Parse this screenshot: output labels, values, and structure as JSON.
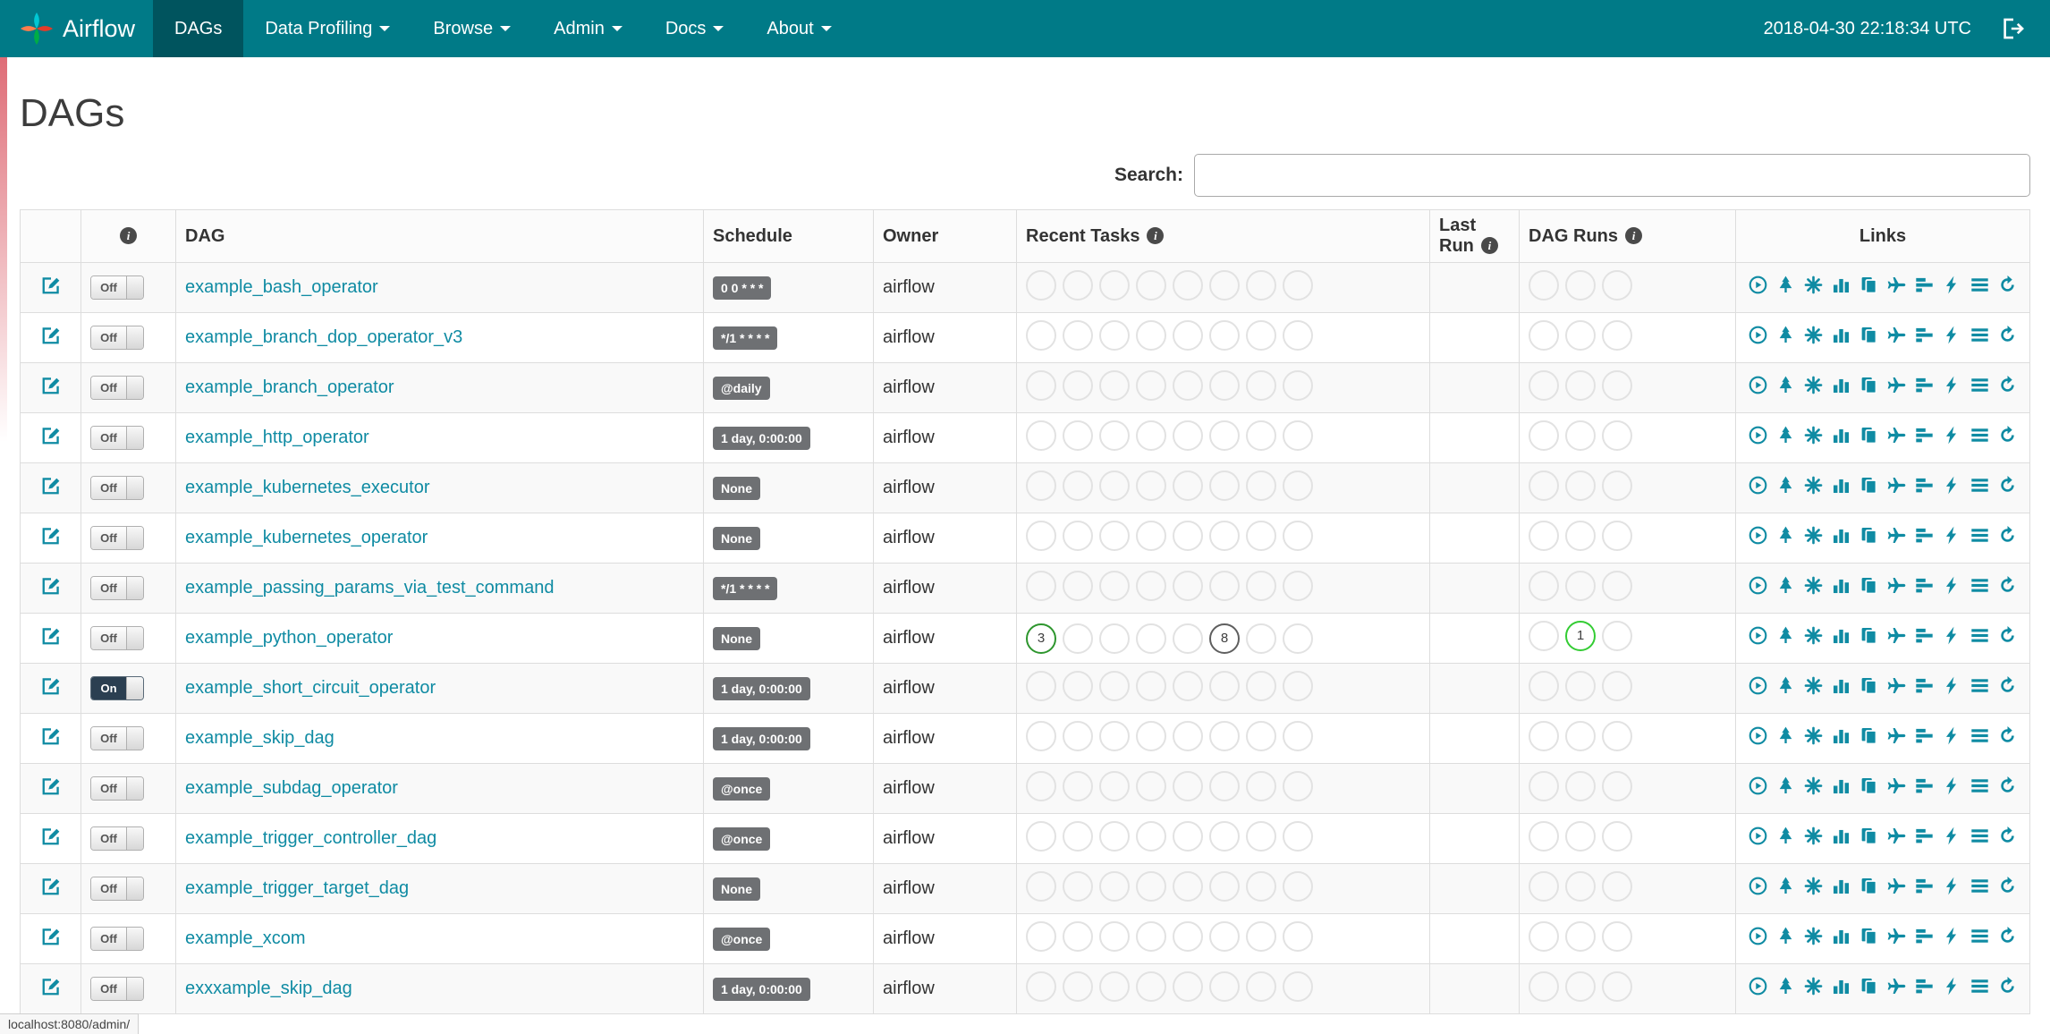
{
  "navbar": {
    "brand": "Airflow",
    "items": [
      {
        "label": "DAGs",
        "active": true,
        "dropdown": false
      },
      {
        "label": "Data Profiling",
        "active": false,
        "dropdown": true
      },
      {
        "label": "Browse",
        "active": false,
        "dropdown": true
      },
      {
        "label": "Admin",
        "active": false,
        "dropdown": true
      },
      {
        "label": "Docs",
        "active": false,
        "dropdown": true
      },
      {
        "label": "About",
        "active": false,
        "dropdown": true
      }
    ],
    "clock": "2018-04-30 22:18:34 UTC"
  },
  "page": {
    "title": "DAGs"
  },
  "search": {
    "label": "Search:",
    "value": ""
  },
  "table": {
    "headers": {
      "dag": "DAG",
      "schedule": "Schedule",
      "owner": "Owner",
      "recent_tasks": "Recent Tasks",
      "last_run": "Last Run",
      "dag_runs": "DAG Runs",
      "links": "Links"
    },
    "toggle": {
      "on_label": "On",
      "off_label": "Off"
    },
    "circle_counts": {
      "recent_tasks": 8,
      "dag_runs": 3
    },
    "state_colors": {
      "success": "#2e962e",
      "running": "#33cc33",
      "none": "#5f5f5f",
      "default": "#e2e2e2"
    },
    "links": [
      "play-circle",
      "tree",
      "graph",
      "bar-chart",
      "copy",
      "plane",
      "gantt",
      "lightning",
      "list",
      "refresh"
    ],
    "rows": [
      {
        "name": "example_bash_operator",
        "schedule": "0 0 * * *",
        "owner": "airflow",
        "paused": true
      },
      {
        "name": "example_branch_dop_operator_v3",
        "schedule": "*/1 * * * *",
        "owner": "airflow",
        "paused": true
      },
      {
        "name": "example_branch_operator",
        "schedule": "@daily",
        "owner": "airflow",
        "paused": true
      },
      {
        "name": "example_http_operator",
        "schedule": "1 day, 0:00:00",
        "owner": "airflow",
        "paused": true
      },
      {
        "name": "example_kubernetes_executor",
        "schedule": "None",
        "owner": "airflow",
        "paused": true
      },
      {
        "name": "example_kubernetes_operator",
        "schedule": "None",
        "owner": "airflow",
        "paused": true
      },
      {
        "name": "example_passing_params_via_test_command",
        "schedule": "*/1 * * * *",
        "owner": "airflow",
        "paused": true
      },
      {
        "name": "example_python_operator",
        "schedule": "None",
        "owner": "airflow",
        "paused": true,
        "recent_tasks": [
          {
            "index": 0,
            "count": "3",
            "state": "success"
          },
          {
            "index": 5,
            "count": "8",
            "state": "none"
          }
        ],
        "dag_runs": [
          {
            "index": 1,
            "count": "1",
            "state": "running"
          }
        ]
      },
      {
        "name": "example_short_circuit_operator",
        "schedule": "1 day, 0:00:00",
        "owner": "airflow",
        "paused": false
      },
      {
        "name": "example_skip_dag",
        "schedule": "1 day, 0:00:00",
        "owner": "airflow",
        "paused": true
      },
      {
        "name": "example_subdag_operator",
        "schedule": "@once",
        "owner": "airflow",
        "paused": true
      },
      {
        "name": "example_trigger_controller_dag",
        "schedule": "@once",
        "owner": "airflow",
        "paused": true
      },
      {
        "name": "example_trigger_target_dag",
        "schedule": "None",
        "owner": "airflow",
        "paused": true
      },
      {
        "name": "example_xcom",
        "schedule": "@once",
        "owner": "airflow",
        "paused": true
      },
      {
        "name": "exxxample_skip_dag",
        "schedule": "1 day, 0:00:00",
        "owner": "airflow",
        "paused": true
      }
    ]
  },
  "statusbar": {
    "url": "localhost:8080/admin/"
  },
  "colors": {
    "navbar_bg": "#007a87",
    "navbar_active_bg": "#00545e",
    "accent": "#0f8ba3",
    "badge_bg": "#6e7073"
  }
}
